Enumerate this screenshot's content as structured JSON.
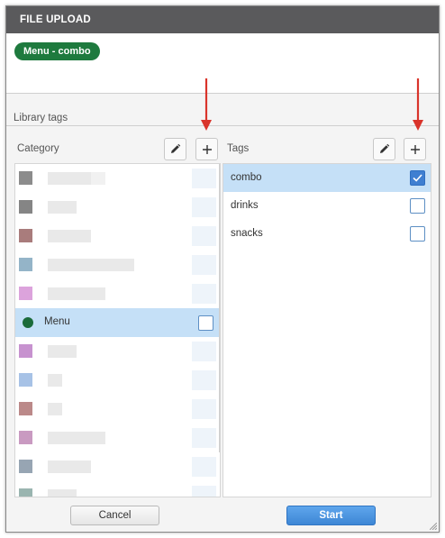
{
  "dialog": {
    "title": "FILE UPLOAD",
    "selected_pill": "Menu - combo"
  },
  "library": {
    "label": "Library tags"
  },
  "category": {
    "label": "Category",
    "edit_icon": "pencil-icon",
    "add_icon": "plus-icon",
    "items": [
      {
        "color": "#8c8c8c",
        "label": "",
        "redacted": true
      },
      {
        "color": "#858585",
        "label": "",
        "redacted": true
      },
      {
        "color": "#a97c7c",
        "label": "",
        "redacted": true
      },
      {
        "color": "#94b4c8",
        "label": "",
        "redacted": true
      },
      {
        "color": "#dca3dc",
        "label": "",
        "redacted": true
      },
      {
        "color": "#1b6b3a",
        "label": "Menu",
        "selected": true
      },
      {
        "color": "#c792cf",
        "label": "",
        "redacted": true
      },
      {
        "color": "#a7c2e6",
        "label": "",
        "redacted": true
      },
      {
        "color": "#bb8989",
        "label": "",
        "redacted": true
      },
      {
        "color": "#c99ac1",
        "label": "",
        "redacted": true
      },
      {
        "color": "#97a5b3",
        "label": "",
        "redacted": true
      },
      {
        "color": "#9ab5b0",
        "label": "",
        "redacted": true
      }
    ]
  },
  "tags": {
    "label": "Tags",
    "edit_icon": "pencil-icon",
    "add_icon": "plus-icon",
    "items": [
      {
        "label": "combo",
        "checked": true,
        "selected": true
      },
      {
        "label": "drinks",
        "checked": false
      },
      {
        "label": "snacks",
        "checked": false
      }
    ]
  },
  "footer": {
    "cancel_label": "Cancel",
    "start_label": "Start"
  },
  "colors": {
    "titlebar": "#5a5a5c",
    "pill": "#1e7a3e",
    "selection": "#c5e0f7",
    "primary": "#3d86d5",
    "annotation_arrow": "#d9342b"
  }
}
